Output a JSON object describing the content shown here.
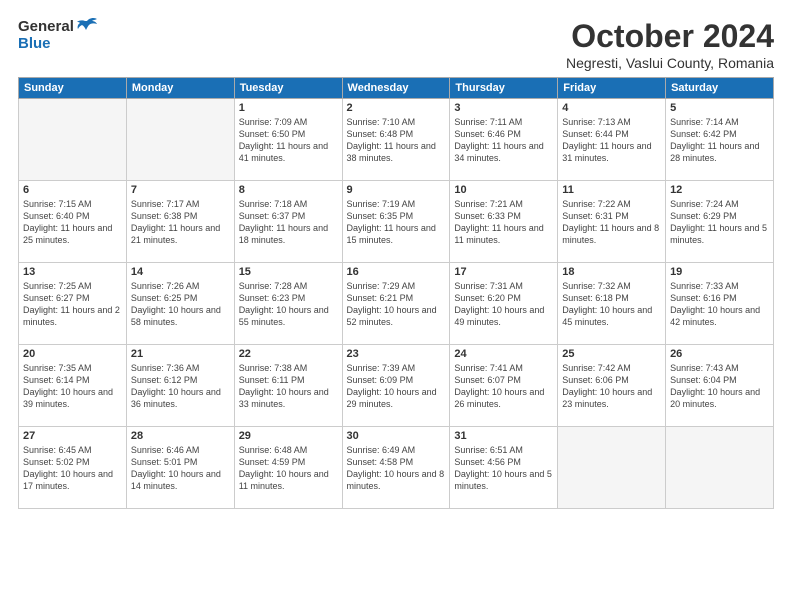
{
  "logo": {
    "general": "General",
    "blue": "Blue",
    "bird_color": "#1a6fb5"
  },
  "header": {
    "month": "October 2024",
    "location": "Negresti, Vaslui County, Romania"
  },
  "weekdays": [
    "Sunday",
    "Monday",
    "Tuesday",
    "Wednesday",
    "Thursday",
    "Friday",
    "Saturday"
  ],
  "weeks": [
    [
      {
        "day": "",
        "sunrise": "",
        "sunset": "",
        "daylight": ""
      },
      {
        "day": "",
        "sunrise": "",
        "sunset": "",
        "daylight": ""
      },
      {
        "day": "1",
        "sunrise": "Sunrise: 7:09 AM",
        "sunset": "Sunset: 6:50 PM",
        "daylight": "Daylight: 11 hours and 41 minutes."
      },
      {
        "day": "2",
        "sunrise": "Sunrise: 7:10 AM",
        "sunset": "Sunset: 6:48 PM",
        "daylight": "Daylight: 11 hours and 38 minutes."
      },
      {
        "day": "3",
        "sunrise": "Sunrise: 7:11 AM",
        "sunset": "Sunset: 6:46 PM",
        "daylight": "Daylight: 11 hours and 34 minutes."
      },
      {
        "day": "4",
        "sunrise": "Sunrise: 7:13 AM",
        "sunset": "Sunset: 6:44 PM",
        "daylight": "Daylight: 11 hours and 31 minutes."
      },
      {
        "day": "5",
        "sunrise": "Sunrise: 7:14 AM",
        "sunset": "Sunset: 6:42 PM",
        "daylight": "Daylight: 11 hours and 28 minutes."
      }
    ],
    [
      {
        "day": "6",
        "sunrise": "Sunrise: 7:15 AM",
        "sunset": "Sunset: 6:40 PM",
        "daylight": "Daylight: 11 hours and 25 minutes."
      },
      {
        "day": "7",
        "sunrise": "Sunrise: 7:17 AM",
        "sunset": "Sunset: 6:38 PM",
        "daylight": "Daylight: 11 hours and 21 minutes."
      },
      {
        "day": "8",
        "sunrise": "Sunrise: 7:18 AM",
        "sunset": "Sunset: 6:37 PM",
        "daylight": "Daylight: 11 hours and 18 minutes."
      },
      {
        "day": "9",
        "sunrise": "Sunrise: 7:19 AM",
        "sunset": "Sunset: 6:35 PM",
        "daylight": "Daylight: 11 hours and 15 minutes."
      },
      {
        "day": "10",
        "sunrise": "Sunrise: 7:21 AM",
        "sunset": "Sunset: 6:33 PM",
        "daylight": "Daylight: 11 hours and 11 minutes."
      },
      {
        "day": "11",
        "sunrise": "Sunrise: 7:22 AM",
        "sunset": "Sunset: 6:31 PM",
        "daylight": "Daylight: 11 hours and 8 minutes."
      },
      {
        "day": "12",
        "sunrise": "Sunrise: 7:24 AM",
        "sunset": "Sunset: 6:29 PM",
        "daylight": "Daylight: 11 hours and 5 minutes."
      }
    ],
    [
      {
        "day": "13",
        "sunrise": "Sunrise: 7:25 AM",
        "sunset": "Sunset: 6:27 PM",
        "daylight": "Daylight: 11 hours and 2 minutes."
      },
      {
        "day": "14",
        "sunrise": "Sunrise: 7:26 AM",
        "sunset": "Sunset: 6:25 PM",
        "daylight": "Daylight: 10 hours and 58 minutes."
      },
      {
        "day": "15",
        "sunrise": "Sunrise: 7:28 AM",
        "sunset": "Sunset: 6:23 PM",
        "daylight": "Daylight: 10 hours and 55 minutes."
      },
      {
        "day": "16",
        "sunrise": "Sunrise: 7:29 AM",
        "sunset": "Sunset: 6:21 PM",
        "daylight": "Daylight: 10 hours and 52 minutes."
      },
      {
        "day": "17",
        "sunrise": "Sunrise: 7:31 AM",
        "sunset": "Sunset: 6:20 PM",
        "daylight": "Daylight: 10 hours and 49 minutes."
      },
      {
        "day": "18",
        "sunrise": "Sunrise: 7:32 AM",
        "sunset": "Sunset: 6:18 PM",
        "daylight": "Daylight: 10 hours and 45 minutes."
      },
      {
        "day": "19",
        "sunrise": "Sunrise: 7:33 AM",
        "sunset": "Sunset: 6:16 PM",
        "daylight": "Daylight: 10 hours and 42 minutes."
      }
    ],
    [
      {
        "day": "20",
        "sunrise": "Sunrise: 7:35 AM",
        "sunset": "Sunset: 6:14 PM",
        "daylight": "Daylight: 10 hours and 39 minutes."
      },
      {
        "day": "21",
        "sunrise": "Sunrise: 7:36 AM",
        "sunset": "Sunset: 6:12 PM",
        "daylight": "Daylight: 10 hours and 36 minutes."
      },
      {
        "day": "22",
        "sunrise": "Sunrise: 7:38 AM",
        "sunset": "Sunset: 6:11 PM",
        "daylight": "Daylight: 10 hours and 33 minutes."
      },
      {
        "day": "23",
        "sunrise": "Sunrise: 7:39 AM",
        "sunset": "Sunset: 6:09 PM",
        "daylight": "Daylight: 10 hours and 29 minutes."
      },
      {
        "day": "24",
        "sunrise": "Sunrise: 7:41 AM",
        "sunset": "Sunset: 6:07 PM",
        "daylight": "Daylight: 10 hours and 26 minutes."
      },
      {
        "day": "25",
        "sunrise": "Sunrise: 7:42 AM",
        "sunset": "Sunset: 6:06 PM",
        "daylight": "Daylight: 10 hours and 23 minutes."
      },
      {
        "day": "26",
        "sunrise": "Sunrise: 7:43 AM",
        "sunset": "Sunset: 6:04 PM",
        "daylight": "Daylight: 10 hours and 20 minutes."
      }
    ],
    [
      {
        "day": "27",
        "sunrise": "Sunrise: 6:45 AM",
        "sunset": "Sunset: 5:02 PM",
        "daylight": "Daylight: 10 hours and 17 minutes."
      },
      {
        "day": "28",
        "sunrise": "Sunrise: 6:46 AM",
        "sunset": "Sunset: 5:01 PM",
        "daylight": "Daylight: 10 hours and 14 minutes."
      },
      {
        "day": "29",
        "sunrise": "Sunrise: 6:48 AM",
        "sunset": "Sunset: 4:59 PM",
        "daylight": "Daylight: 10 hours and 11 minutes."
      },
      {
        "day": "30",
        "sunrise": "Sunrise: 6:49 AM",
        "sunset": "Sunset: 4:58 PM",
        "daylight": "Daylight: 10 hours and 8 minutes."
      },
      {
        "day": "31",
        "sunrise": "Sunrise: 6:51 AM",
        "sunset": "Sunset: 4:56 PM",
        "daylight": "Daylight: 10 hours and 5 minutes."
      },
      {
        "day": "",
        "sunrise": "",
        "sunset": "",
        "daylight": ""
      },
      {
        "day": "",
        "sunrise": "",
        "sunset": "",
        "daylight": ""
      }
    ]
  ]
}
